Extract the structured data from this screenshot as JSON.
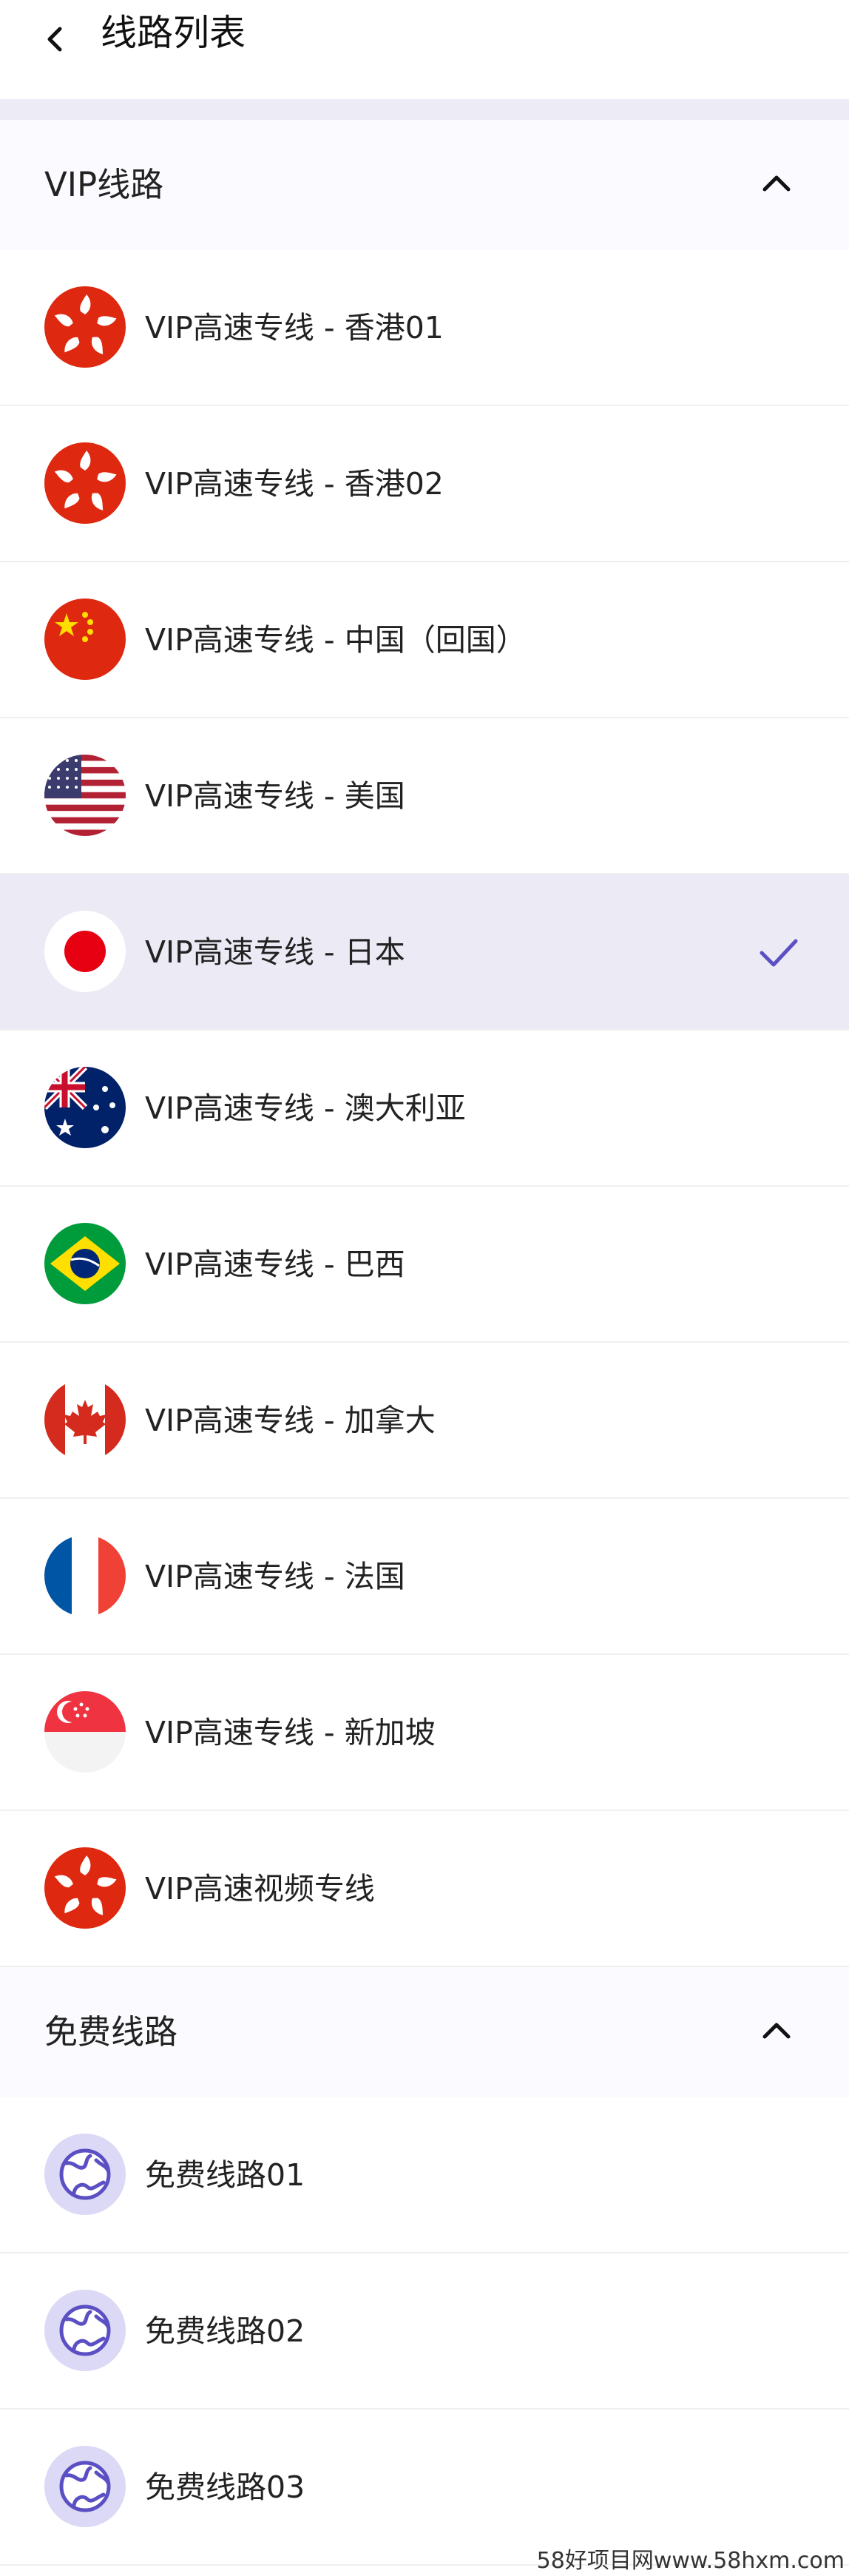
{
  "header": {
    "title": "线路列表"
  },
  "sections": [
    {
      "title": "VIP线路",
      "rows": [
        {
          "label": "VIP高速专线 - 香港01",
          "flag": "hong-kong-flag-icon"
        },
        {
          "label": "VIP高速专线 - 香港02",
          "flag": "hong-kong-flag-icon"
        },
        {
          "label": "VIP高速专线 - 中国（回国）",
          "flag": "china-flag-icon"
        },
        {
          "label": "VIP高速专线 - 美国",
          "flag": "usa-flag-icon"
        },
        {
          "label": "VIP高速专线 - 日本",
          "flag": "japan-flag-icon",
          "selected": true
        },
        {
          "label": "VIP高速专线 - 澳大利亚",
          "flag": "australia-flag-icon"
        },
        {
          "label": "VIP高速专线 - 巴西",
          "flag": "brazil-flag-icon"
        },
        {
          "label": "VIP高速专线 - 加拿大",
          "flag": "canada-flag-icon"
        },
        {
          "label": "VIP高速专线 - 法国",
          "flag": "france-flag-icon"
        },
        {
          "label": "VIP高速专线 - 新加坡",
          "flag": "singapore-flag-icon"
        },
        {
          "label": "VIP高速视频专线",
          "flag": "hong-kong-flag-icon"
        }
      ]
    },
    {
      "title": "免费线路",
      "rows": [
        {
          "label": "免费线路01",
          "flag": "globe-icon"
        },
        {
          "label": "免费线路02",
          "flag": "globe-icon"
        },
        {
          "label": "免费线路03",
          "flag": "globe-icon"
        }
      ]
    }
  ],
  "watermark": "58好项目网www.58hxm.com",
  "colors": {
    "accent": "#5b4fc4",
    "selected_bg": "#ebeaf5",
    "section_gap": "#ecebf6"
  }
}
